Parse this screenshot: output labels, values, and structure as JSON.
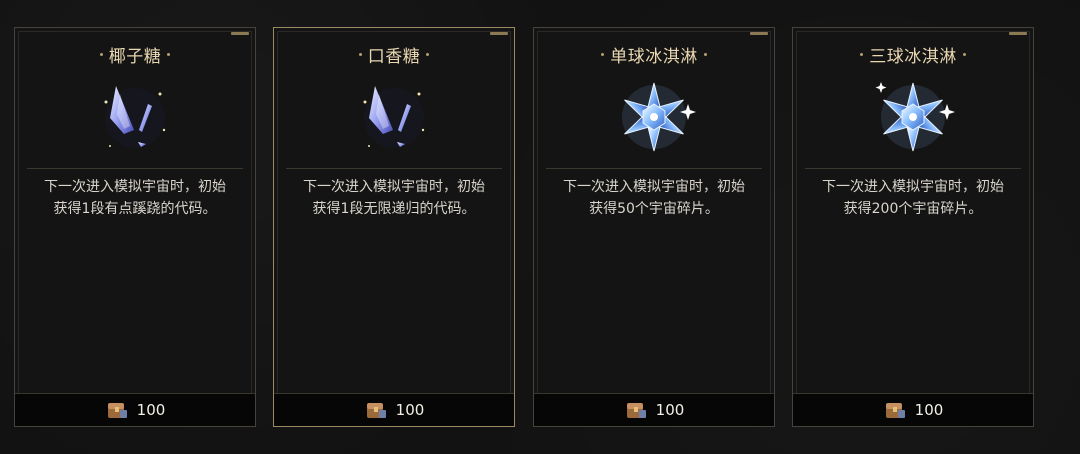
{
  "cards": [
    {
      "title": "椰子糖",
      "desc_line1": "下一次进入模拟宇宙时，初始",
      "desc_line2": "获得1段有点蹊跷的代码。",
      "price": "100",
      "art_icon": "crystal-shards-icon"
    },
    {
      "title": "口香糖",
      "desc_line1": "下一次进入模拟宇宙时，初始",
      "desc_line2": "获得1段无限递归的代码。",
      "price": "100",
      "art_icon": "crystal-shards-icon"
    },
    {
      "title": "单球冰淇淋",
      "desc_line1": "下一次进入模拟宇宙时，初始",
      "desc_line2": "获得50个宇宙碎片。",
      "price": "100",
      "art_icon": "snowflake-icon"
    },
    {
      "title": "三球冰淇淋",
      "desc_line1": "下一次进入模拟宇宙时，初始",
      "desc_line2": "获得200个宇宙碎片。",
      "price": "100",
      "art_icon": "snowflake-icon"
    }
  ],
  "colors": {
    "accent": "#e8d7b0",
    "border": "#47423a",
    "selected_border": "#9a8a64"
  },
  "currency_icon": "treasure-chest-icon"
}
